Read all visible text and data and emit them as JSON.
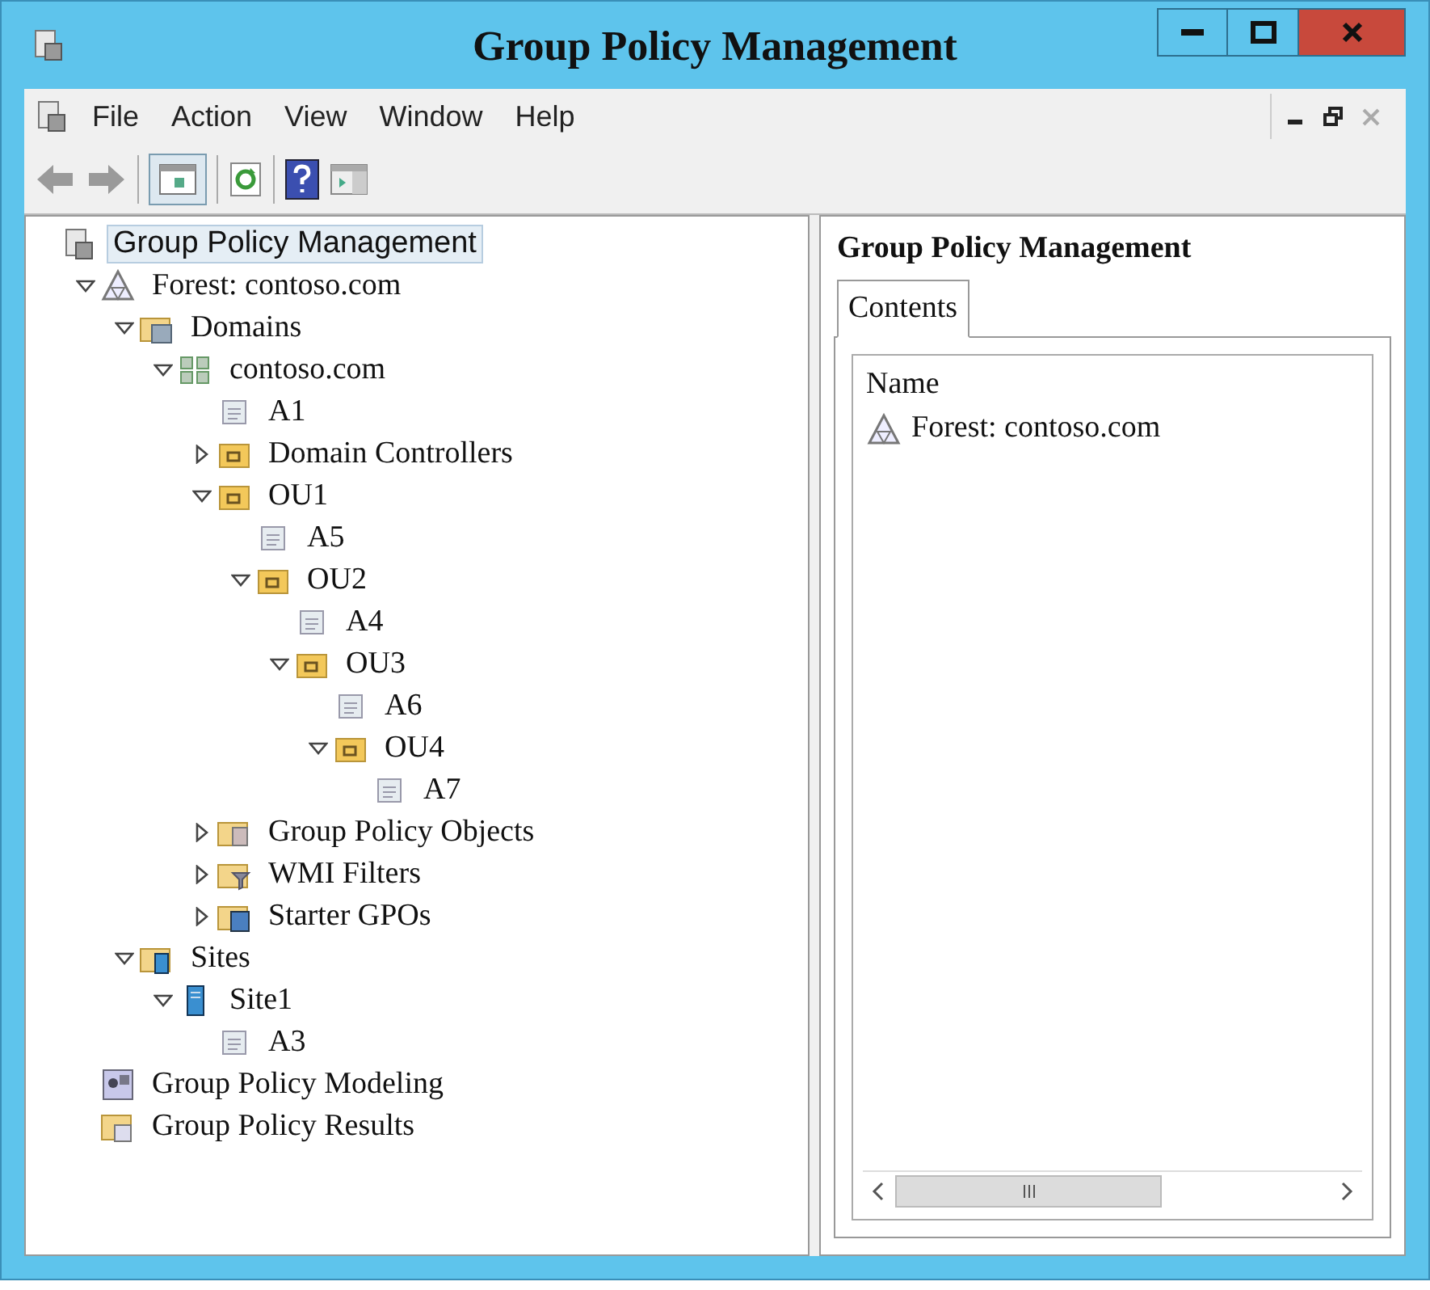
{
  "window": {
    "title": "Group Policy Management"
  },
  "menu": [
    "File",
    "Action",
    "View",
    "Window",
    "Help"
  ],
  "tree": [
    {
      "label": "Group Policy Management",
      "kind": "console",
      "selected": true,
      "children": [
        {
          "label": "Forest: contoso.com",
          "kind": "forest",
          "expanded": true,
          "selected": false,
          "children": [
            {
              "label": "Domains",
              "kind": "domains",
              "expanded": true,
              "selected": false,
              "children": [
                {
                  "label": "contoso.com",
                  "kind": "domain",
                  "expanded": true,
                  "selected": false,
                  "children": [
                    {
                      "label": "A1",
                      "kind": "gpo",
                      "selected": false
                    },
                    {
                      "label": "Domain Controllers",
                      "kind": "ou",
                      "expanded": false,
                      "selected": false
                    },
                    {
                      "label": "OU1",
                      "kind": "ou",
                      "expanded": true,
                      "selected": false,
                      "children": [
                        {
                          "label": "A5",
                          "kind": "gpo",
                          "selected": false
                        },
                        {
                          "label": "OU2",
                          "kind": "ou",
                          "expanded": true,
                          "selected": false,
                          "children": [
                            {
                              "label": "A4",
                              "kind": "gpo",
                              "selected": false
                            },
                            {
                              "label": "OU3",
                              "kind": "ou",
                              "expanded": true,
                              "selected": false,
                              "children": [
                                {
                                  "label": "A6",
                                  "kind": "gpo",
                                  "selected": false
                                },
                                {
                                  "label": "OU4",
                                  "kind": "ou",
                                  "expanded": true,
                                  "selected": false,
                                  "children": [
                                    {
                                      "label": "A7",
                                      "kind": "gpo",
                                      "selected": false
                                    }
                                  ]
                                }
                              ]
                            }
                          ]
                        }
                      ]
                    },
                    {
                      "label": "Group Policy Objects",
                      "kind": "gpo-folder",
                      "expanded": false,
                      "selected": false
                    },
                    {
                      "label": "WMI Filters",
                      "kind": "wmi",
                      "expanded": false,
                      "selected": false
                    },
                    {
                      "label": "Starter GPOs",
                      "kind": "starter",
                      "expanded": false,
                      "selected": false
                    }
                  ]
                }
              ]
            },
            {
              "label": "Sites",
              "kind": "sites",
              "expanded": true,
              "selected": false,
              "children": [
                {
                  "label": "Site1",
                  "kind": "site",
                  "expanded": true,
                  "selected": false,
                  "children": [
                    {
                      "label": "A3",
                      "kind": "gpo",
                      "selected": false
                    }
                  ]
                }
              ]
            }
          ]
        },
        {
          "label": "Group Policy Modeling",
          "kind": "modeling",
          "selected": false
        },
        {
          "label": "Group Policy Results",
          "kind": "results",
          "selected": false
        }
      ]
    }
  ],
  "details": {
    "title": "Group Policy Management",
    "tabs": [
      {
        "label": "Contents",
        "selected": true
      }
    ],
    "columns": [
      "Name"
    ],
    "rows": [
      {
        "name": "Forest: contoso.com",
        "kind": "forest"
      }
    ]
  }
}
